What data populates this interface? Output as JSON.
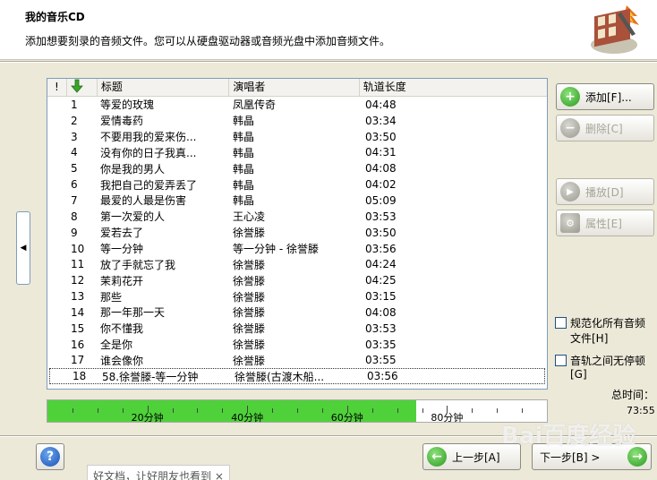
{
  "header": {
    "title": "我的音乐CD",
    "subtitle": "添加想要刻录的音频文件。您可以从硬盘驱动器或音频光盘中添加音频文件。"
  },
  "list": {
    "columns": {
      "index": "!",
      "title": "标题",
      "artist": "演唱者",
      "duration": "轨道长度"
    },
    "rows": [
      {
        "n": "1",
        "title": "等爱的玫瑰",
        "artist": "凤凰传奇",
        "dur": "04:48"
      },
      {
        "n": "2",
        "title": "爱情毒药",
        "artist": "韩晶",
        "dur": "03:34"
      },
      {
        "n": "3",
        "title": "不要用我的爱来伤...",
        "artist": "韩晶",
        "dur": "03:50"
      },
      {
        "n": "4",
        "title": "没有你的日子我真...",
        "artist": "韩晶",
        "dur": "04:31"
      },
      {
        "n": "5",
        "title": "你是我的男人",
        "artist": "韩晶",
        "dur": "04:08"
      },
      {
        "n": "6",
        "title": "我把自己的爱弄丢了",
        "artist": "韩晶",
        "dur": "04:02"
      },
      {
        "n": "7",
        "title": "最爱的人最是伤害",
        "artist": "韩晶",
        "dur": "05:09"
      },
      {
        "n": "8",
        "title": "第一次爱的人",
        "artist": "王心凌",
        "dur": "03:53"
      },
      {
        "n": "9",
        "title": "爱若去了",
        "artist": "徐誉滕",
        "dur": "03:50"
      },
      {
        "n": "10",
        "title": "等一分钟",
        "artist": "等一分钟 - 徐誉滕",
        "dur": "03:56"
      },
      {
        "n": "11",
        "title": "放了手就忘了我",
        "artist": "徐誉滕",
        "dur": "04:24"
      },
      {
        "n": "12",
        "title": "茉莉花开",
        "artist": "徐誉滕",
        "dur": "04:25"
      },
      {
        "n": "13",
        "title": "那些",
        "artist": "徐誉滕",
        "dur": "03:15"
      },
      {
        "n": "14",
        "title": "那一年那一天",
        "artist": "徐誉滕",
        "dur": "04:08"
      },
      {
        "n": "15",
        "title": "你不懂我",
        "artist": "徐誉滕",
        "dur": "03:53"
      },
      {
        "n": "16",
        "title": "全是你",
        "artist": "徐誉滕",
        "dur": "03:35"
      },
      {
        "n": "17",
        "title": "谁会像你",
        "artist": "徐誉滕",
        "dur": "03:55"
      },
      {
        "n": "18",
        "title": "58.徐誉滕-等一分钟",
        "artist": "徐誉滕(古渡木船...",
        "dur": "03:56"
      }
    ]
  },
  "timeline": {
    "labels": [
      "20分钟",
      "40分钟",
      "60分钟",
      "80分钟"
    ],
    "max_minutes": 100,
    "used_minutes": 73.9,
    "fill_color": "#4fd13a"
  },
  "buttons": {
    "add": "添加[F]...",
    "delete": "删除[C]",
    "play": "播放[D]",
    "properties": "属性[E]",
    "back": "上一步[A]",
    "next": "下一步[B] >"
  },
  "options": {
    "normalize": "规范化所有音频文件[H]",
    "no_gap": "音轨之间无停顿[G]"
  },
  "total": {
    "label": "总时间：",
    "value": "73:55"
  },
  "toast": "好文档，让好朋友也看到 ×",
  "watermark": "Bai百度经验",
  "icons": {
    "add": "plus-icon",
    "delete": "minus-icon",
    "play": "play-icon",
    "properties": "properties-icon",
    "back": "arrow-left-icon",
    "next": "arrow-right-icon",
    "help": "question-icon"
  }
}
